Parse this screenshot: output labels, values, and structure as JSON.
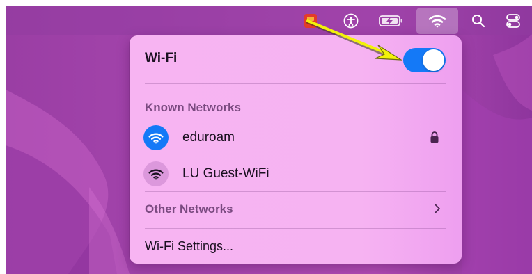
{
  "menubar": {
    "icons": [
      "app-icon",
      "accessibility-icon",
      "battery-charging-icon",
      "wifi-icon",
      "search-icon",
      "control-center-icon"
    ]
  },
  "panel": {
    "title": "Wi-Fi",
    "toggle_state": "on",
    "known_networks_label": "Known Networks",
    "networks": [
      {
        "name": "eduroam",
        "connected": true,
        "secured": true
      },
      {
        "name": "LU Guest-WiFi",
        "connected": false,
        "secured": false
      }
    ],
    "other_networks_label": "Other Networks",
    "settings_label": "Wi-Fi Settings..."
  },
  "colors": {
    "accent": "#1479f7",
    "panel": "#f6b3f2",
    "annotation_arrow": "#f2f20a"
  }
}
